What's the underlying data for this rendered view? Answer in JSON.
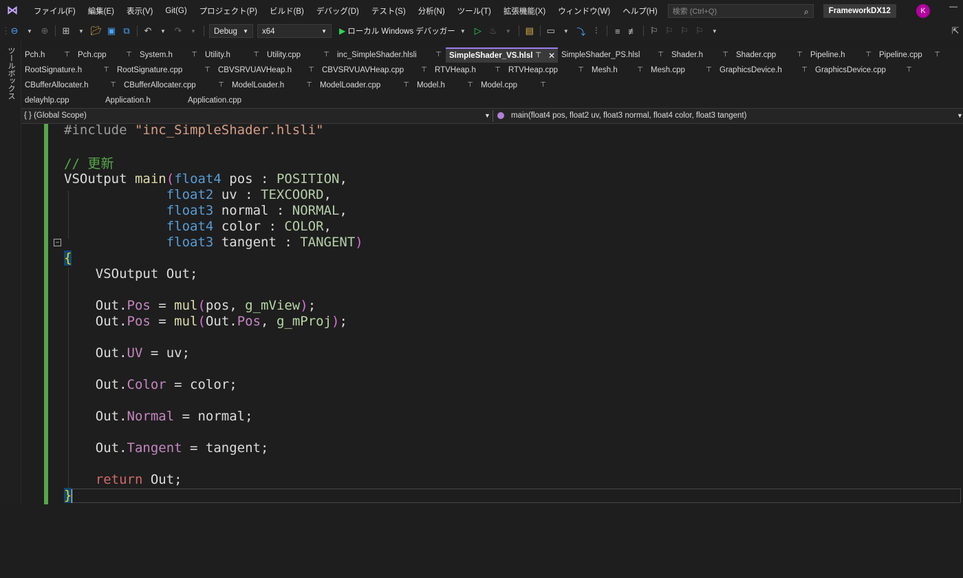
{
  "menubar": {
    "logo": "⋈",
    "items": [
      "ファイル(F)",
      "編集(E)",
      "表示(V)",
      "Git(G)",
      "プロジェクト(P)",
      "ビルド(B)",
      "デバッグ(D)",
      "テスト(S)",
      "分析(N)",
      "ツール(T)",
      "拡張機能(X)",
      "ウィンドウ(W)",
      "ヘルプ(H)"
    ],
    "search_placeholder": "検索 (Ctrl+Q)",
    "project_name": "FrameworkDX12",
    "avatar_initial": "K"
  },
  "toolbar": {
    "config": "Debug",
    "platform": "x64",
    "run_target": "ローカル Windows デバッガー"
  },
  "sidebar": {
    "label": "ツールボックス"
  },
  "tabs": {
    "row1": [
      {
        "label": "Pch.h"
      },
      {
        "label": "Pch.cpp"
      },
      {
        "label": "System.h"
      },
      {
        "label": "Utility.h"
      },
      {
        "label": "Utility.cpp"
      },
      {
        "label": "inc_SimpleShader.hlsli"
      },
      {
        "label": "SimpleShader_VS.hlsl",
        "active": true
      },
      {
        "label": "SimpleShader_PS.hlsl"
      },
      {
        "label": "Shader.h"
      },
      {
        "label": "Shader.cpp"
      },
      {
        "label": "Pipeline.h"
      },
      {
        "label": "Pipeline.cpp"
      }
    ],
    "row2": [
      {
        "label": "RootSignature.h"
      },
      {
        "label": "RootSignature.cpp"
      },
      {
        "label": "CBVSRVUAVHeap.h"
      },
      {
        "label": "CBVSRVUAVHeap.cpp"
      },
      {
        "label": "RTVHeap.h"
      },
      {
        "label": "RTVHeap.cpp"
      },
      {
        "label": "Mesh.h"
      },
      {
        "label": "Mesh.cpp"
      },
      {
        "label": "GraphicsDevice.h"
      },
      {
        "label": "GraphicsDevice.cpp"
      }
    ],
    "row3": [
      {
        "label": "CBufferAllocater.h"
      },
      {
        "label": "CBufferAllocater.cpp"
      },
      {
        "label": "ModelLoader.h"
      },
      {
        "label": "ModelLoader.cpp"
      },
      {
        "label": "Model.h"
      },
      {
        "label": "Model.cpp"
      }
    ],
    "row4": [
      {
        "label": "delayhlp.cpp"
      },
      {
        "label": "Application.h"
      },
      {
        "label": "Application.cpp"
      }
    ]
  },
  "navbar": {
    "scope": "(Global Scope)",
    "scope_icon": "{ }",
    "function": "main(float4 pos, float2 uv, float3 normal, float4 color, float3 tangent)"
  },
  "code": {
    "include_directive": "#include",
    "include_file": "\"inc_SimpleShader.hlsli\"",
    "comment": "// 更新",
    "return_type": "VSOutput",
    "func_name": "main",
    "params": [
      {
        "type": "float4",
        "name": "pos",
        "semantic": "POSITION"
      },
      {
        "type": "float2",
        "name": "uv",
        "semantic": "TEXCOORD"
      },
      {
        "type": "float3",
        "name": "normal",
        "semantic": "NORMAL"
      },
      {
        "type": "float4",
        "name": "color",
        "semantic": "COLOR"
      },
      {
        "type": "float3",
        "name": "tangent",
        "semantic": "TANGENT"
      }
    ],
    "local_decl": "VSOutput Out;",
    "mul": "mul",
    "view_matrix": "g_mView",
    "proj_matrix": "g_mProj",
    "fields": [
      "Pos",
      "UV",
      "Color",
      "Normal",
      "Tangent"
    ],
    "return_kw": "return",
    "return_val": "Out;"
  }
}
